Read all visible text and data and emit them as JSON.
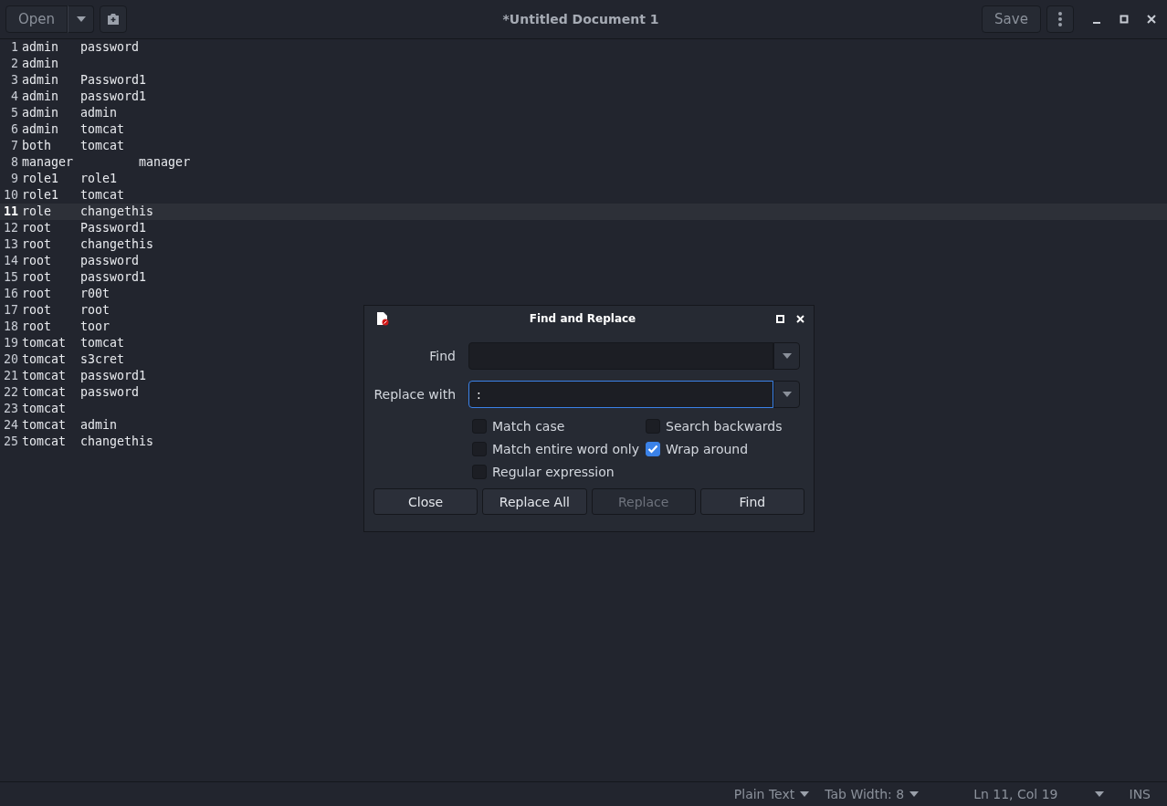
{
  "header": {
    "open_button": "Open",
    "title": "*Untitled Document 1",
    "save_button": "Save"
  },
  "lines": [
    {
      "number": "1",
      "text": "admin\tpassword",
      "current": false
    },
    {
      "number": "2",
      "text": "admin",
      "current": false
    },
    {
      "number": "3",
      "text": "admin\tPassword1",
      "current": false
    },
    {
      "number": "4",
      "text": "admin\tpassword1",
      "current": false
    },
    {
      "number": "5",
      "text": "admin\tadmin",
      "current": false
    },
    {
      "number": "6",
      "text": "admin\ttomcat",
      "current": false
    },
    {
      "number": "7",
      "text": "both\ttomcat",
      "current": false
    },
    {
      "number": "8",
      "text": "manager\t\tmanager",
      "current": false
    },
    {
      "number": "9",
      "text": "role1\trole1",
      "current": false
    },
    {
      "number": "10",
      "text": "role1\ttomcat",
      "current": false
    },
    {
      "number": "11",
      "text": "role\tchangethis",
      "current": true
    },
    {
      "number": "12",
      "text": "root\tPassword1",
      "current": false
    },
    {
      "number": "13",
      "text": "root\tchangethis",
      "current": false
    },
    {
      "number": "14",
      "text": "root\tpassword",
      "current": false
    },
    {
      "number": "15",
      "text": "root\tpassword1",
      "current": false
    },
    {
      "number": "16",
      "text": "root\tr00t",
      "current": false
    },
    {
      "number": "17",
      "text": "root\troot",
      "current": false
    },
    {
      "number": "18",
      "text": "root\ttoor",
      "current": false
    },
    {
      "number": "19",
      "text": "tomcat\ttomcat",
      "current": false
    },
    {
      "number": "20",
      "text": "tomcat\ts3cret",
      "current": false
    },
    {
      "number": "21",
      "text": "tomcat\tpassword1",
      "current": false
    },
    {
      "number": "22",
      "text": "tomcat\tpassword",
      "current": false
    },
    {
      "number": "23",
      "text": "tomcat",
      "current": false
    },
    {
      "number": "24",
      "text": "tomcat\tadmin",
      "current": false
    },
    {
      "number": "25",
      "text": "tomcat\tchangethis",
      "current": false
    }
  ],
  "dialog": {
    "title": "Find and Replace",
    "find_label": "Find",
    "replace_label": "Replace with",
    "replace_value": ":",
    "options": [
      {
        "label": "Match case",
        "checked": false
      },
      {
        "label": "Search backwards",
        "checked": false
      },
      {
        "label": "Match entire word only",
        "checked": false
      },
      {
        "label": "Wrap around",
        "checked": true
      },
      {
        "label": "Regular expression",
        "checked": false
      }
    ],
    "buttons": [
      {
        "label": "Close",
        "disabled": false
      },
      {
        "label": "Replace All",
        "disabled": false
      },
      {
        "label": "Replace",
        "disabled": true
      },
      {
        "label": "Find",
        "disabled": false
      }
    ]
  },
  "status_bar": {
    "language": "Plain Text",
    "tab_width": "Tab Width: 8",
    "position": "Ln 11, Col 19",
    "mode": "INS"
  }
}
